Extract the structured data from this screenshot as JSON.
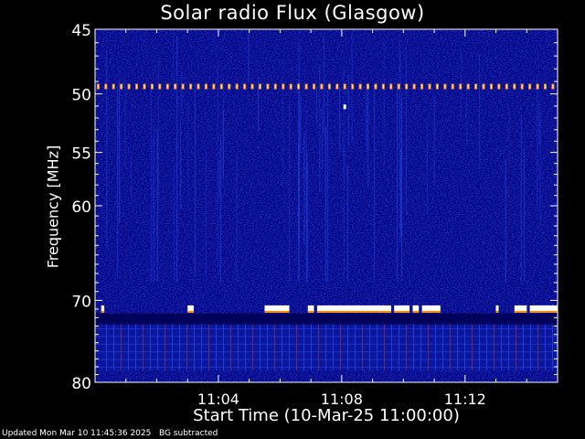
{
  "chart_data": {
    "type": "heatmap",
    "title": "Solar radio Flux (Glasgow)",
    "xlabel": "Start Time (10-Mar-25 11:00:00)",
    "ylabel": "Frequency [MHz]",
    "x_ticks": [
      "11:04",
      "11:08",
      "11:12"
    ],
    "x_tick_values_min": [
      4,
      8,
      12
    ],
    "xlim_min": [
      0,
      15
    ],
    "y_ticks": [
      "45",
      "50",
      "55",
      "60",
      "70",
      "80"
    ],
    "y_tick_values": [
      45,
      50,
      55,
      60,
      70,
      80
    ],
    "ylim": [
      80,
      45
    ],
    "y_scale": "log",
    "colormap": [
      "#000080",
      "#1428c8",
      "#c83232",
      "#ff8c00",
      "#ffffff"
    ],
    "features": [
      {
        "kind": "dotted_line",
        "freq_mhz": 49.4,
        "t_start_min": 0.1,
        "t_end_min": 14.9
      },
      {
        "kind": "dot",
        "freq_mhz": 51.1,
        "t_min": 8.1
      },
      {
        "kind": "band",
        "freq_mhz": 71.0,
        "segments_min": [
          [
            0.2,
            0.3
          ],
          [
            3.0,
            3.2
          ],
          [
            5.5,
            6.3
          ],
          [
            6.9,
            7.1
          ],
          [
            7.2,
            9.6
          ],
          [
            9.7,
            10.2
          ],
          [
            10.3,
            10.5
          ],
          [
            10.6,
            11.2
          ],
          [
            13.0,
            13.05
          ],
          [
            13.6,
            14.0
          ],
          [
            14.1,
            15.0
          ]
        ]
      },
      {
        "kind": "dark_gap",
        "freq_lo_mhz": 71.5,
        "freq_hi_mhz": 72.8
      },
      {
        "kind": "interference",
        "freq_lo_mhz": 72.8,
        "freq_hi_mhz": 78.5
      }
    ]
  },
  "footer": {
    "updated": "Updated Mon Mar 10 11:45:36 2025",
    "note": "BG subtracted"
  }
}
